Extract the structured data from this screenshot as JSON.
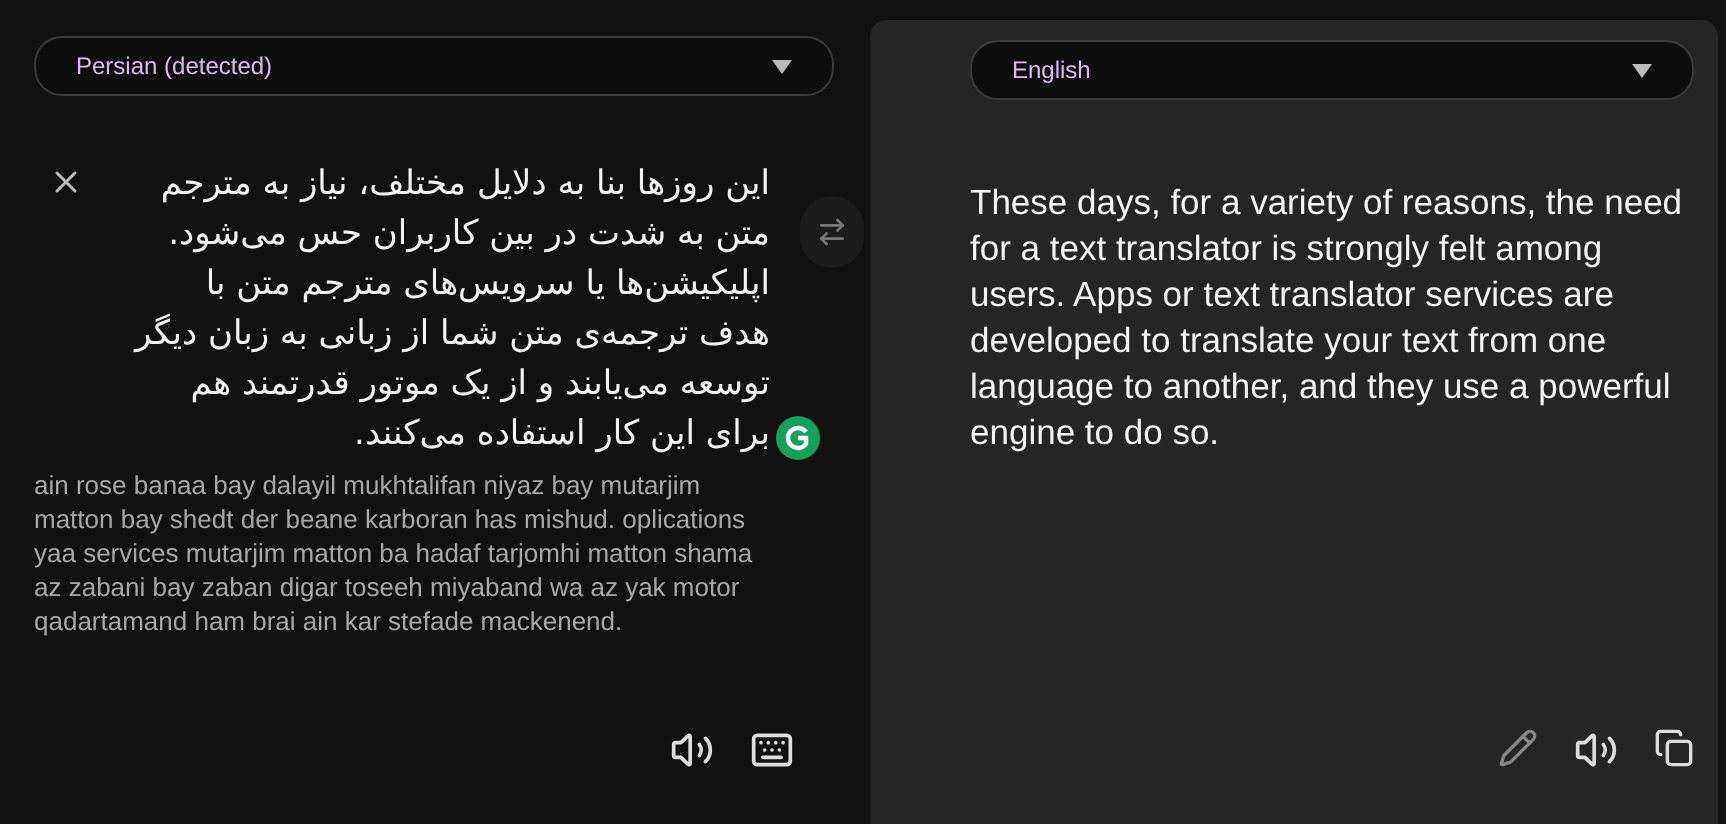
{
  "source": {
    "language": "Persian (detected)",
    "text": "این روزها بنا به دلایل مختلف، نیاز به مترجم متن به شدت در بین کاربران حس می‌شود. اپلیکیشن‌ها یا سرویس‌های مترجم متن با هدف ترجمه‌ی متن شما از زبانی به زبان دیگر توسعه می‌یابند و از یک موتور قدرتمند هم برای این کار استفاده می‌کنند.",
    "transliteration": "ain rose banaa bay dalayil mukhtalifan niyaz bay mutarjim matton bay shedt der beane karboran has mishud. oplications yaa services mutarjim matton ba hadaf tarjomhi matton shama az zabani bay zaban digar toseeh miyaband wa az yak motor qadartamand ham brai ain kar stefade mackenend."
  },
  "target": {
    "language": "English",
    "text": "These days, for a variety of reasons, the need for a text translator is strongly felt among users. Apps or text translator services are developed to translate your text from one language to another, and they use a powerful engine to do so."
  }
}
